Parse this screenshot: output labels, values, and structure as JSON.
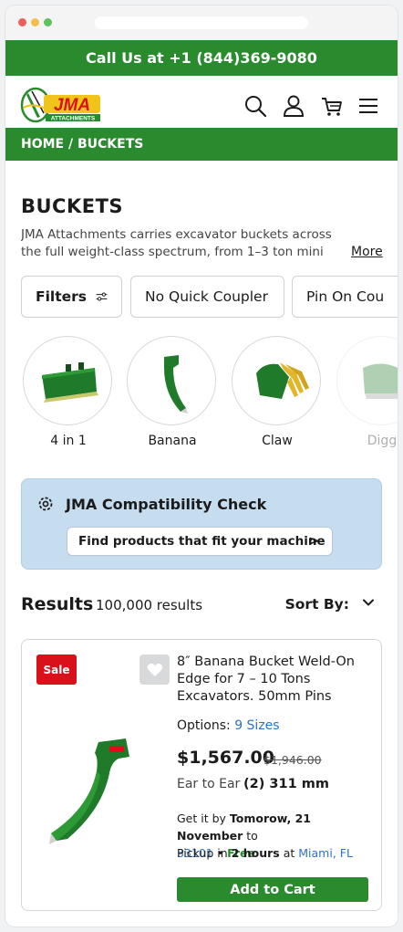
{
  "topbar": {
    "call_text": "Call Us at +1 (844)369-9080"
  },
  "header": {
    "logo_text": "JMA",
    "logo_subtext": "ATTACHMENTS",
    "icons": [
      "search-icon",
      "account-icon",
      "cart-icon",
      "menu-icon"
    ]
  },
  "breadcrumb": {
    "text": "HOME / BUCKETS"
  },
  "category": {
    "title": "BUCKETS",
    "description": "JMA Attachments carries excavator buckets across the full weight-class spectrum, from 1–3 ton mini",
    "more_label": "More"
  },
  "filters": {
    "filters_label": "Filters",
    "chips": [
      "No Quick Coupler",
      "Pin On Cou"
    ]
  },
  "subcategories": [
    {
      "label": "4 in 1"
    },
    {
      "label": "Banana"
    },
    {
      "label": "Claw"
    },
    {
      "label": "Digg"
    }
  ],
  "compatibility": {
    "title": "JMA Compatibility Check",
    "button_label": "Find products that fit your machine",
    "chevron": ">"
  },
  "results": {
    "label": "Results",
    "count": "100,000 results",
    "sort_label": "Sort By:"
  },
  "product": {
    "badge": "Sale",
    "name": "8″ Banana Bucket Weld-On Edge for 7 – 10 Tons Excavators. 50mm Pins",
    "options_label": "Options:",
    "options_value": "9 Sizes",
    "price": "$1,567.00",
    "old_price": "$1,946.00",
    "spec_label": "Ear to Ear",
    "spec_value": "(2) 311 mm",
    "delivery_prefix": "Get it by",
    "delivery_date": "Tomorow, 21 November",
    "delivery_to": "to",
    "zip": "33101",
    "bullet": "•",
    "free": "Free",
    "pickup_prefix": "Pickup in",
    "pickup_time": "2 hours",
    "pickup_at": "at",
    "pickup_location": "Miami, FL",
    "add_to_cart": "Add to Cart"
  },
  "colors": {
    "brand_green": "#2a8a2e",
    "sale_red": "#d9111b",
    "link_blue": "#2d72c9",
    "compat_bg": "#c6dcef"
  }
}
